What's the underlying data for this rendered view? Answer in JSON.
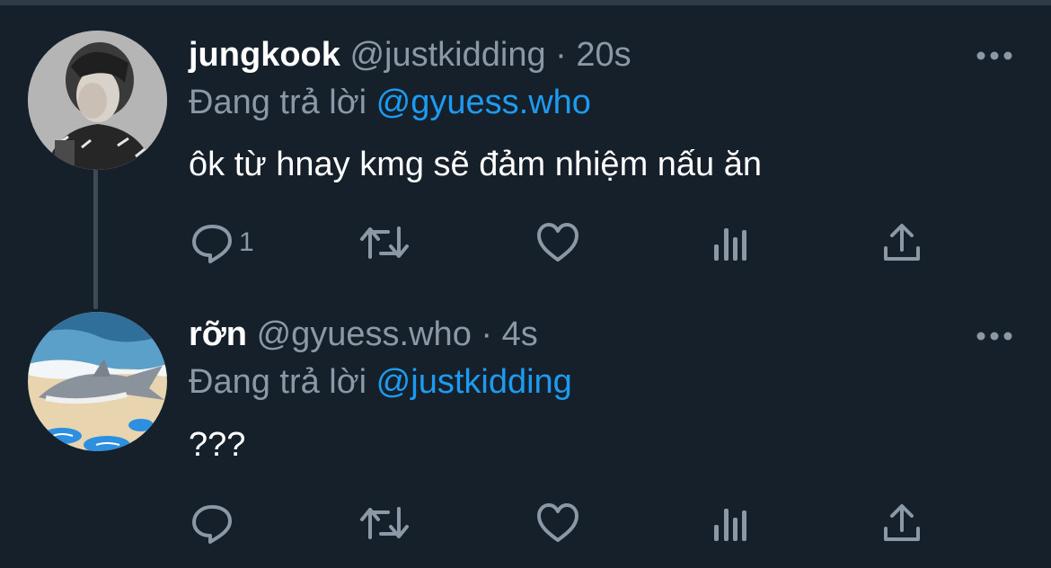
{
  "tweets": [
    {
      "name": "jungkook",
      "handle": "@justkidding",
      "separator": "·",
      "time": "20s",
      "reply_prefix": "Đang trả lời ",
      "reply_to": "@gyuess.who",
      "text": "ôk từ hnay kmg sẽ đảm nhiệm nấu ăn",
      "reply_count": "1",
      "avatar": "person-photo"
    },
    {
      "name": "rỡn",
      "handle": "@gyuess.who",
      "separator": "·",
      "time": "4s",
      "reply_prefix": "Đang trả lời ",
      "reply_to": "@justkidding",
      "text": "???",
      "reply_count": "",
      "avatar": "shark-with-sneakers"
    }
  ],
  "icons": [
    "more-icon",
    "reply-icon",
    "retweet-icon",
    "like-icon",
    "views-icon",
    "share-icon"
  ],
  "colors": {
    "background": "#15202b",
    "text": "#ffffff",
    "muted": "#8b98a5",
    "accent": "#1d9bf0",
    "thread_line": "#3d4a57"
  }
}
